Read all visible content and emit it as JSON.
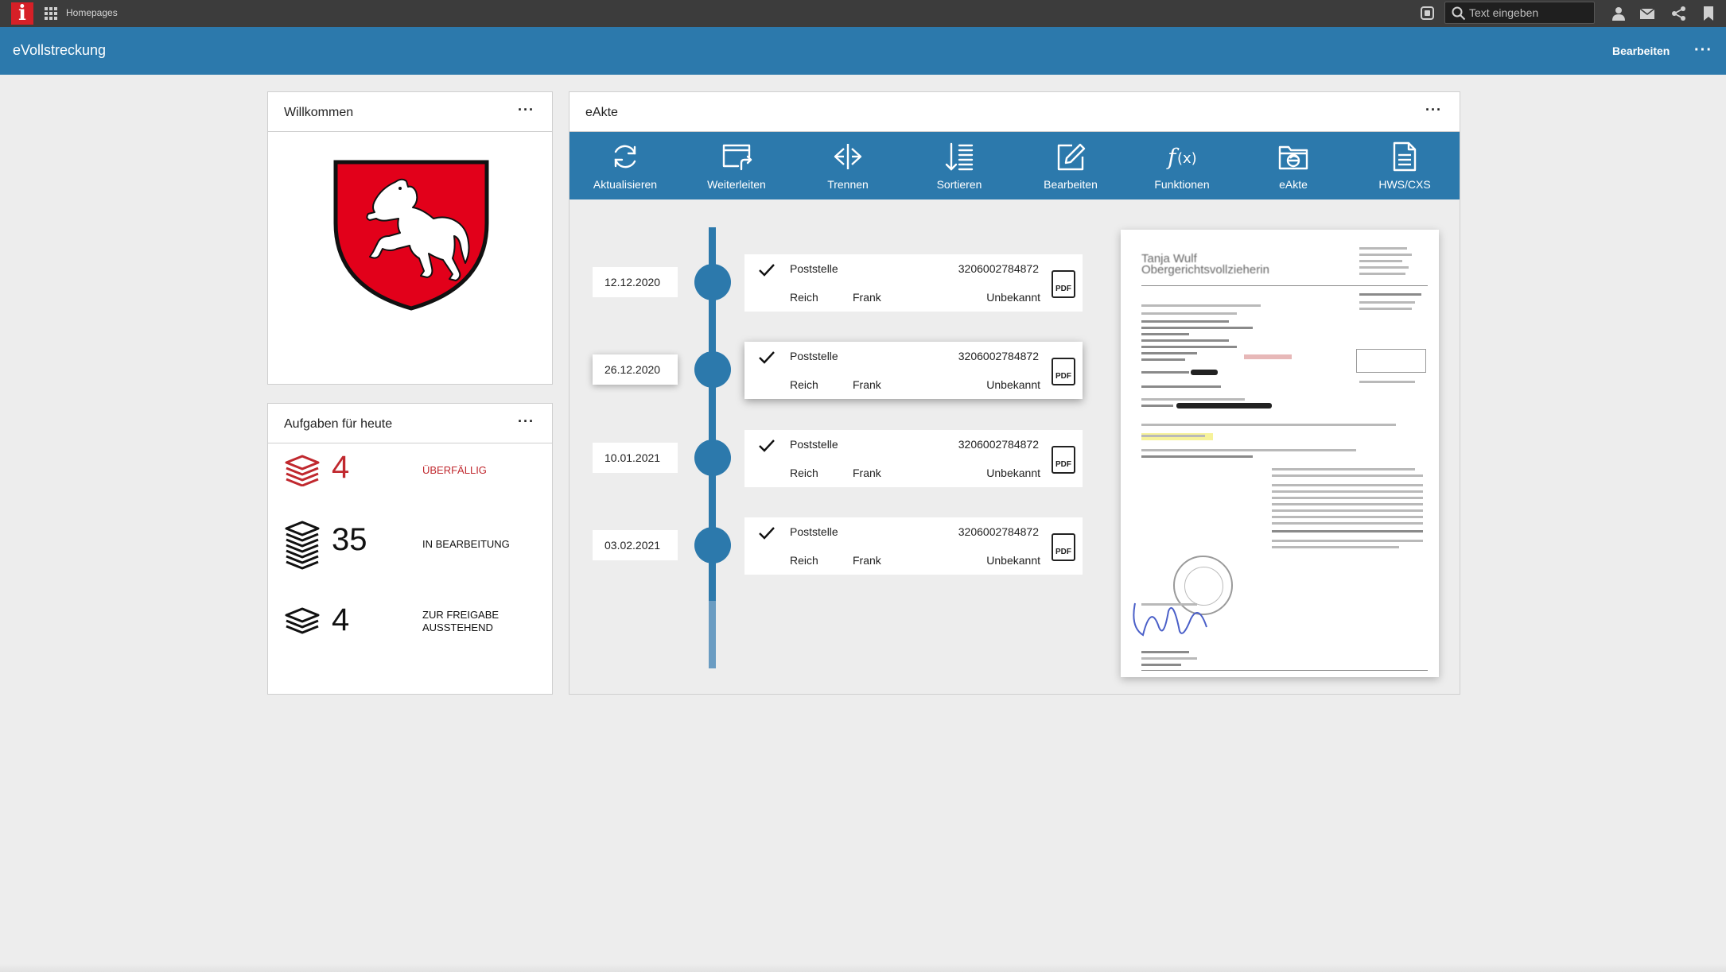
{
  "topbar": {
    "logo": "i",
    "breadcrumb": "Homepages",
    "search_placeholder": "Text eingeben",
    "icons": [
      "window-icon",
      "search-icon",
      "user-icon",
      "mail-icon",
      "share-icon",
      "bookmark-icon"
    ]
  },
  "app": {
    "title": "eVollstreckung",
    "edit_label": "Bearbeiten",
    "more_label": "···"
  },
  "welcome": {
    "title": "Willkommen",
    "more_label": "···",
    "emblem": "coat-of-arms-horse",
    "colors": {
      "shield": "#e2001a",
      "horse": "#ffffff"
    }
  },
  "tasks": {
    "title": "Aufgaben für heute",
    "more_label": "···",
    "items": [
      {
        "count": "4",
        "label": "ÜBERFÄLLIG",
        "color": "#c0282e"
      },
      {
        "count": "35",
        "label": "IN BEARBEITUNG",
        "color": "#111111"
      },
      {
        "count": "4",
        "label": "ZUR FREIGABE AUSSTEHEND",
        "color": "#111111"
      }
    ]
  },
  "eakte": {
    "title": "eAkte",
    "more_label": "···",
    "toolbar": [
      {
        "label": "Aktualisieren",
        "icon": "refresh-icon"
      },
      {
        "label": "Weiterleiten",
        "icon": "forward-icon"
      },
      {
        "label": "Trennen",
        "icon": "split-icon"
      },
      {
        "label": "Sortieren",
        "icon": "sort-icon"
      },
      {
        "label": "Bearbeiten",
        "icon": "edit-icon"
      },
      {
        "label": "Funktionen",
        "icon": "function-icon"
      },
      {
        "label": "eAkte",
        "icon": "eakte-folder-icon"
      },
      {
        "label": "HWS/CXS",
        "icon": "document-icon"
      }
    ],
    "entries": [
      {
        "date": "12.12.2020",
        "sender": "Poststelle",
        "number": "3206002784872",
        "col1": "Reich",
        "col2": "Frank",
        "col3": "Unbekannt",
        "file": "PDF",
        "selected": false
      },
      {
        "date": "26.12.2020",
        "sender": "Poststelle",
        "number": "3206002784872",
        "col1": "Reich",
        "col2": "Frank",
        "col3": "Unbekannt",
        "file": "PDF",
        "selected": true
      },
      {
        "date": "10.01.2021",
        "sender": "Poststelle",
        "number": "3206002784872",
        "col1": "Reich",
        "col2": "Frank",
        "col3": "Unbekannt",
        "file": "PDF",
        "selected": false
      },
      {
        "date": "03.02.2021",
        "sender": "Poststelle",
        "number": "3206002784872",
        "col1": "Reich",
        "col2": "Frank",
        "col3": "Unbekannt",
        "file": "PDF",
        "selected": false
      }
    ],
    "preview": {
      "name": "Tanja Wulf",
      "role": "Obergerichtsvollzieherin"
    },
    "accent": "#2c79ac"
  }
}
